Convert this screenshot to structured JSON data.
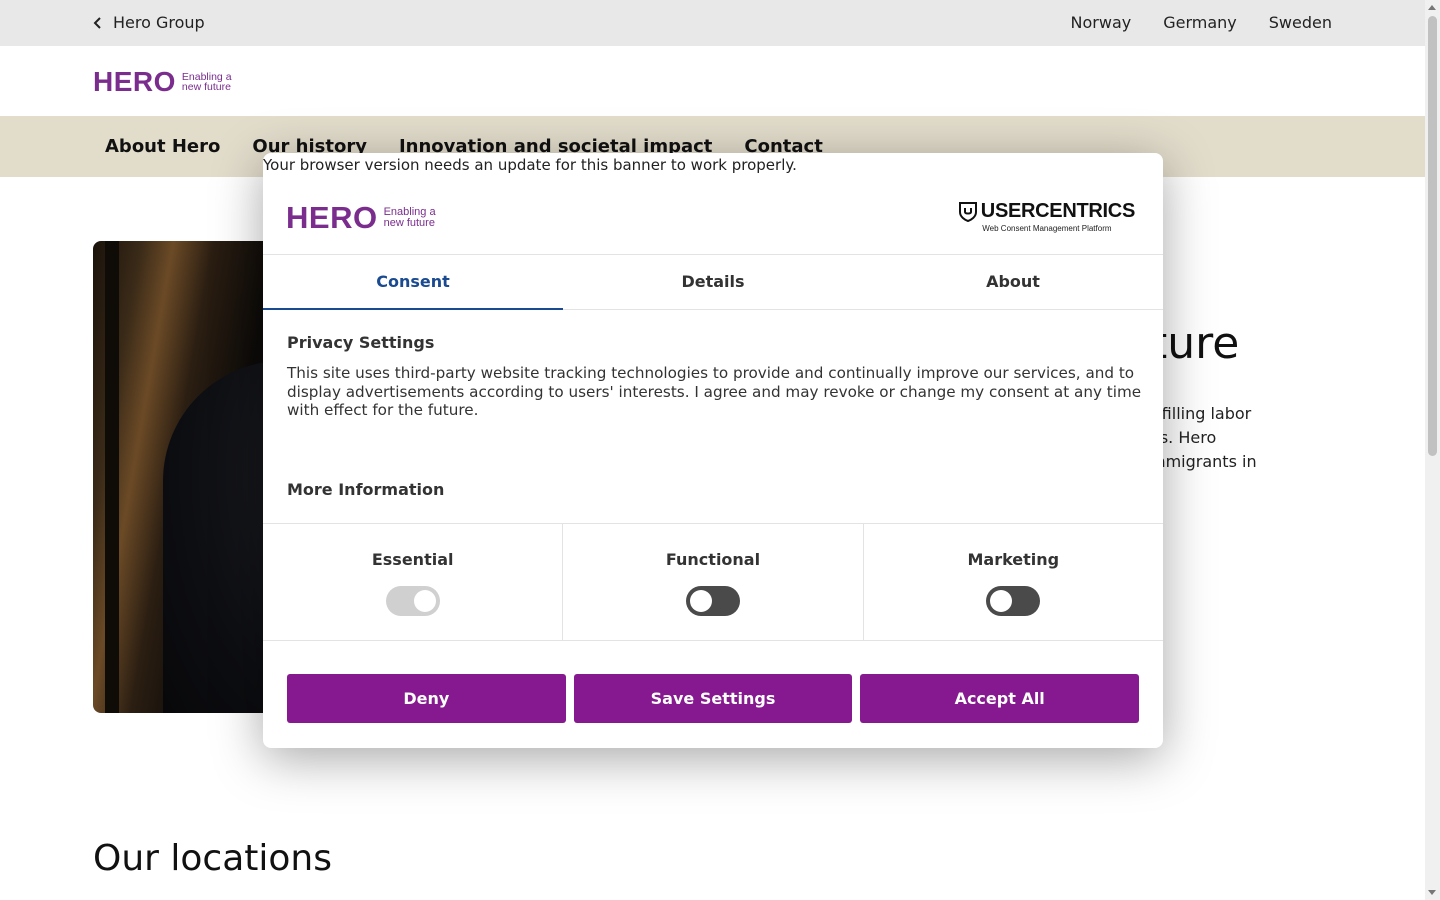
{
  "topbar": {
    "back_label": "Hero Group",
    "countries": [
      "Norway",
      "Germany",
      "Sweden"
    ]
  },
  "logo": {
    "word": "HERO",
    "tagline_line1": "Enabling a",
    "tagline_line2": "new future"
  },
  "nav": {
    "items": [
      "About Hero",
      "Our history",
      "Innovation and societal impact",
      "Contact"
    ]
  },
  "hero": {
    "title_fragment": "ture",
    "text_lines": [
      "r filling labor",
      "es. Hero",
      "mmigrants in"
    ]
  },
  "locations_heading": "Our locations",
  "consent": {
    "update_note": "Your browser version needs an update for this banner to work properly.",
    "brand": {
      "name": "USERCENTRICS",
      "subtitle": "Web Consent Management Platform"
    },
    "tabs": [
      {
        "label": "Consent",
        "active": true
      },
      {
        "label": "Details",
        "active": false
      },
      {
        "label": "About",
        "active": false
      }
    ],
    "privacy_title": "Privacy Settings",
    "privacy_text": "This site uses third-party website tracking technologies to provide and continually improve our services, and to display advertisements according to users' interests. I agree and may revoke or change my consent at any time with effect for the future.",
    "more_info": "More Information",
    "categories": [
      {
        "label": "Essential",
        "enabled": true,
        "locked": true
      },
      {
        "label": "Functional",
        "enabled": false,
        "locked": false
      },
      {
        "label": "Marketing",
        "enabled": false,
        "locked": false
      }
    ],
    "buttons": {
      "deny": "Deny",
      "save": "Save Settings",
      "accept": "Accept All"
    },
    "accent_color": "#86198f",
    "tab_active_color": "#1a4a8f"
  }
}
